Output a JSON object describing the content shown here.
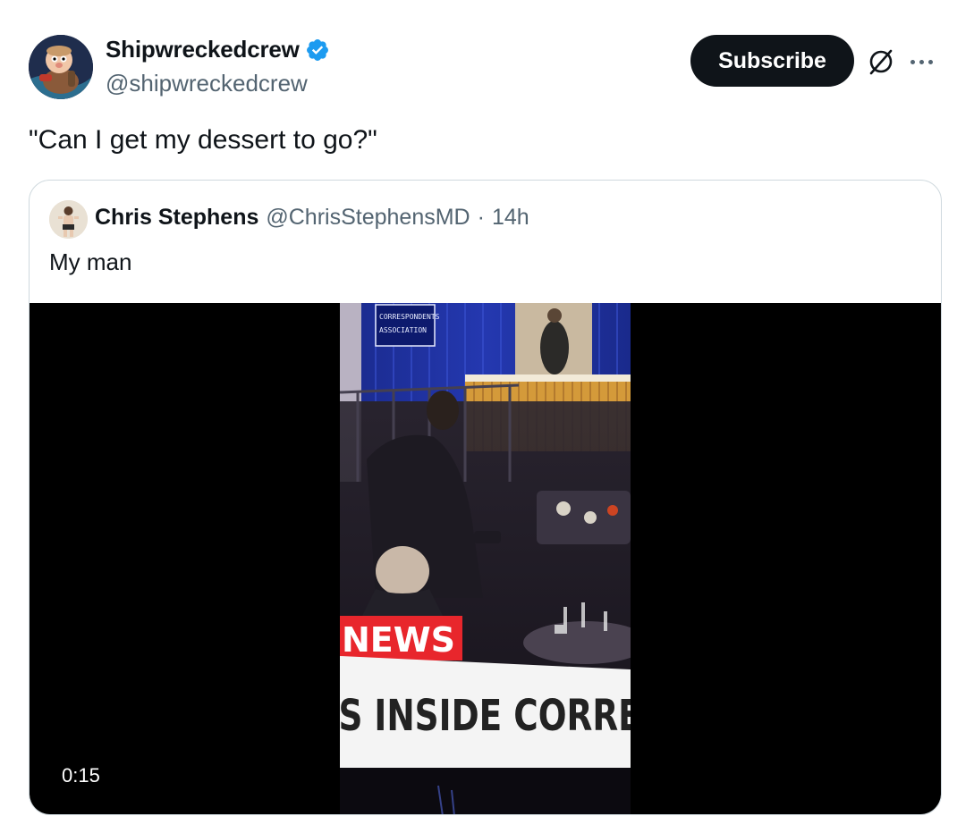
{
  "author": {
    "display_name": "Shipwreckedcrew",
    "handle": "@shipwreckedcrew",
    "verified": true
  },
  "actions": {
    "subscribe_label": "Subscribe",
    "grok_icon": "grok-icon",
    "more_icon": "more-icon"
  },
  "tweet": {
    "text": "\"Can I get my dessert to go?\""
  },
  "quote": {
    "display_name": "Chris Stephens",
    "handle": "@ChrisStephensMD",
    "separator": "·",
    "time": "14h",
    "text": "My man",
    "video": {
      "duration": "0:15",
      "overlay_sign": "CORRESPONDENTS ASSOCIATION",
      "chyron_tag": "NEWS",
      "chyron_text": "S INSIDE CORRESPON"
    }
  },
  "colors": {
    "text_primary": "#0f1419",
    "text_secondary": "#536471",
    "verified_blue": "#1d9bf0",
    "border": "#cfd9de",
    "news_red": "#cc0000"
  }
}
